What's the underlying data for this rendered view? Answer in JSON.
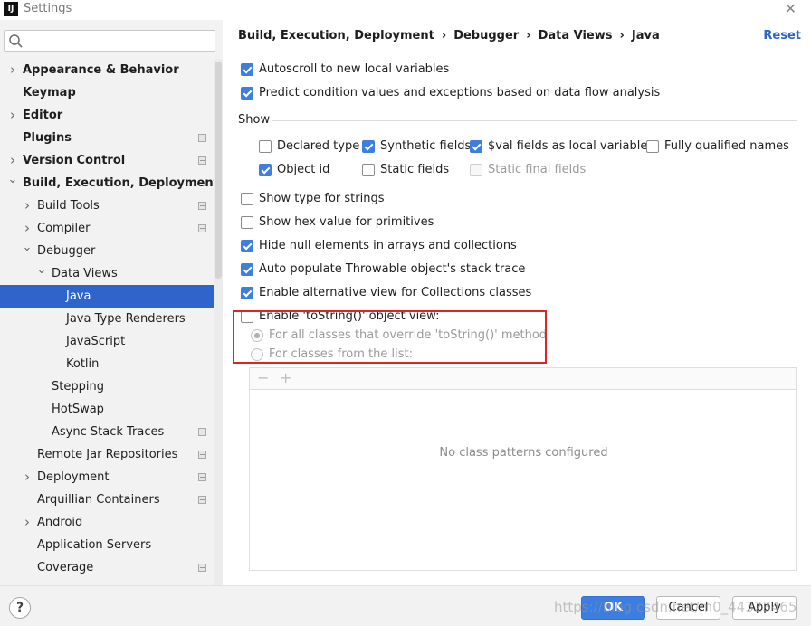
{
  "window": {
    "title": "Settings",
    "logo_text": "IJ"
  },
  "search": {
    "placeholder": ""
  },
  "sidebar": {
    "items": [
      {
        "label": "Appearance & Behavior",
        "indent": 0,
        "arrow": "right",
        "bold": true,
        "project": false,
        "selected": false
      },
      {
        "label": "Keymap",
        "indent": 0,
        "arrow": "",
        "bold": true,
        "project": false,
        "selected": false
      },
      {
        "label": "Editor",
        "indent": 0,
        "arrow": "right",
        "bold": true,
        "project": false,
        "selected": false
      },
      {
        "label": "Plugins",
        "indent": 0,
        "arrow": "",
        "bold": true,
        "project": true,
        "selected": false
      },
      {
        "label": "Version Control",
        "indent": 0,
        "arrow": "right",
        "bold": true,
        "project": true,
        "selected": false
      },
      {
        "label": "Build, Execution, Deployment",
        "indent": 0,
        "arrow": "down",
        "bold": true,
        "project": false,
        "selected": false
      },
      {
        "label": "Build Tools",
        "indent": 1,
        "arrow": "right",
        "bold": false,
        "project": true,
        "selected": false
      },
      {
        "label": "Compiler",
        "indent": 1,
        "arrow": "right",
        "bold": false,
        "project": true,
        "selected": false
      },
      {
        "label": "Debugger",
        "indent": 1,
        "arrow": "down",
        "bold": false,
        "project": false,
        "selected": false
      },
      {
        "label": "Data Views",
        "indent": 2,
        "arrow": "down",
        "bold": false,
        "project": false,
        "selected": false
      },
      {
        "label": "Java",
        "indent": 3,
        "arrow": "",
        "bold": false,
        "project": false,
        "selected": true
      },
      {
        "label": "Java Type Renderers",
        "indent": 3,
        "arrow": "",
        "bold": false,
        "project": false,
        "selected": false
      },
      {
        "label": "JavaScript",
        "indent": 3,
        "arrow": "",
        "bold": false,
        "project": false,
        "selected": false
      },
      {
        "label": "Kotlin",
        "indent": 3,
        "arrow": "",
        "bold": false,
        "project": false,
        "selected": false
      },
      {
        "label": "Stepping",
        "indent": 2,
        "arrow": "",
        "bold": false,
        "project": false,
        "selected": false
      },
      {
        "label": "HotSwap",
        "indent": 2,
        "arrow": "",
        "bold": false,
        "project": false,
        "selected": false
      },
      {
        "label": "Async Stack Traces",
        "indent": 2,
        "arrow": "",
        "bold": false,
        "project": true,
        "selected": false
      },
      {
        "label": "Remote Jar Repositories",
        "indent": 1,
        "arrow": "",
        "bold": false,
        "project": true,
        "selected": false
      },
      {
        "label": "Deployment",
        "indent": 1,
        "arrow": "right",
        "bold": false,
        "project": true,
        "selected": false
      },
      {
        "label": "Arquillian Containers",
        "indent": 1,
        "arrow": "",
        "bold": false,
        "project": true,
        "selected": false
      },
      {
        "label": "Android",
        "indent": 1,
        "arrow": "right",
        "bold": false,
        "project": false,
        "selected": false
      },
      {
        "label": "Application Servers",
        "indent": 1,
        "arrow": "",
        "bold": false,
        "project": false,
        "selected": false
      },
      {
        "label": "Coverage",
        "indent": 1,
        "arrow": "",
        "bold": false,
        "project": true,
        "selected": false
      }
    ]
  },
  "breadcrumb": [
    "Build, Execution, Deployment",
    "Debugger",
    "Data Views",
    "Java"
  ],
  "reset_label": "Reset",
  "options": {
    "autoscroll": {
      "label": "Autoscroll to new local variables",
      "checked": true
    },
    "predict": {
      "label": "Predict condition values and exceptions based on data flow analysis",
      "checked": true
    },
    "show_label": "Show",
    "declared_type": {
      "label": "Declared type",
      "checked": false
    },
    "synthetic_fields": {
      "label": "Synthetic fields",
      "checked": true
    },
    "val_fields": {
      "label": "$val fields as local variables",
      "checked": true
    },
    "fully_qualified": {
      "label": "Fully qualified names",
      "checked": false
    },
    "object_id": {
      "label": "Object id",
      "checked": true
    },
    "static_fields": {
      "label": "Static fields",
      "checked": false
    },
    "static_final_fields": {
      "label": "Static final fields",
      "checked": false,
      "disabled": true
    },
    "type_for_strings": {
      "label": "Show type for strings",
      "checked": false
    },
    "hex_value": {
      "label": "Show hex value for primitives",
      "checked": false
    },
    "hide_null": {
      "label": "Hide null elements in arrays and collections",
      "checked": true
    },
    "auto_populate": {
      "label": "Auto populate Throwable object's stack trace",
      "checked": true
    },
    "alt_view": {
      "label": "Enable alternative view for Collections classes",
      "checked": true
    },
    "tostring_view": {
      "label": "Enable 'toString()' object view:",
      "checked": false
    },
    "tostring_all": {
      "label": "For all classes that override 'toString()' method",
      "selected": true
    },
    "tostring_list": {
      "label": "For classes from the list:",
      "selected": false
    }
  },
  "list": {
    "empty_text": "No class patterns configured",
    "remove_glyph": "−",
    "add_glyph": "+"
  },
  "buttons": {
    "ok": "OK",
    "cancel": "Cancel",
    "apply": "Apply",
    "help": "?"
  },
  "watermark": "https://blog.csdn.net/m0_44323465",
  "colors": {
    "accent": "#3b7de0",
    "selection": "#2f65ca",
    "highlight": "#e02424",
    "link": "#2a64c4"
  }
}
